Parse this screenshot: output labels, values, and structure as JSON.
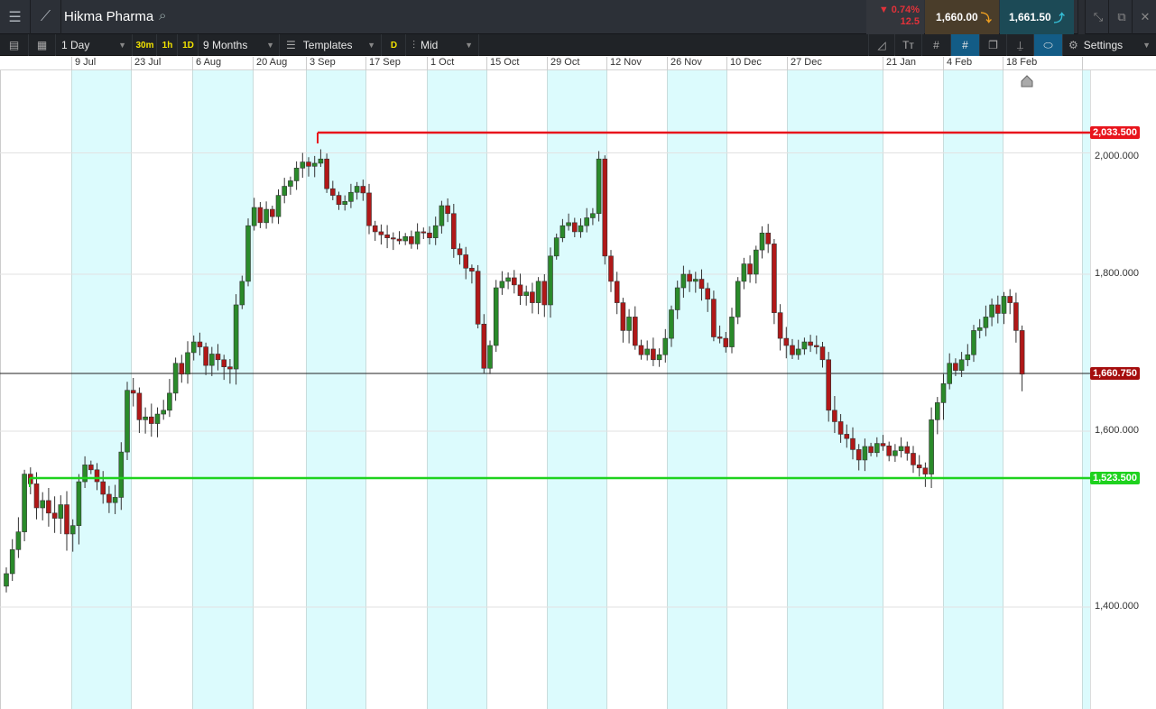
{
  "header": {
    "title": "Hikma Pharma",
    "change_pct": "0.74%",
    "change_abs": "12.5",
    "sell_price": "1,660.00",
    "buy_price": "1,661.50"
  },
  "toolbar": {
    "interval": "1 Day",
    "quick": [
      "30m",
      "1h",
      "1D"
    ],
    "range": "9 Months",
    "templates": "Templates",
    "d_label": "D",
    "price_type": "Mid",
    "settings": "Settings"
  },
  "colors": {
    "up": "#2a8a2a",
    "down": "#b01818",
    "resistance": "#e8141c",
    "support": "#1ed21e",
    "band": "#dcfbfd"
  },
  "chart_data": {
    "type": "candlestick",
    "x_tick_labels": [
      "9 Jul",
      "23 Jul",
      "6 Aug",
      "20 Aug",
      "3 Sep",
      "17 Sep",
      "1 Oct",
      "15 Oct",
      "29 Oct",
      "12 Nov",
      "26 Nov",
      "10 Dec",
      "27 Dec",
      "21 Jan",
      "4 Feb",
      "18 Feb"
    ],
    "y_tick_labels": [
      "1,400.000",
      "1,600.000",
      "1,800.000",
      "2,000.000"
    ],
    "y_ticks": [
      1400,
      1600,
      1800,
      2000
    ],
    "hlines": [
      {
        "label": "2,033.500",
        "value": 2033.5,
        "kind": "resistance"
      },
      {
        "label": "1,523.500",
        "value": 1523.5,
        "kind": "support"
      }
    ],
    "current": {
      "label": "1,660.750",
      "value": 1660.75
    },
    "first_open": 1420,
    "closes": [
      1432,
      1455,
      1472,
      1530,
      1518,
      1495,
      1502,
      1490,
      1485,
      1498,
      1470,
      1478,
      1520,
      1545,
      1537,
      1520,
      1508,
      1500,
      1505,
      1566,
      1643,
      1640,
      1612,
      1615,
      1608,
      1618,
      1622,
      1640,
      1675,
      1660,
      1690,
      1705,
      1698,
      1672,
      1688,
      1680,
      1670,
      1667,
      1757,
      1790,
      1880,
      1910,
      1885,
      1907,
      1895,
      1930,
      1945,
      1954,
      1975,
      1985,
      1978,
      1983,
      1990,
      1941,
      1930,
      1915,
      1920,
      1935,
      1945,
      1934,
      1880,
      1870,
      1865,
      1860,
      1858,
      1855,
      1862,
      1850,
      1870,
      1868,
      1860,
      1880,
      1913,
      1900,
      1842,
      1832,
      1810,
      1805,
      1730,
      1668,
      1700,
      1781,
      1790,
      1795,
      1785,
      1770,
      1775,
      1760,
      1790,
      1757,
      1830,
      1860,
      1880,
      1885,
      1870,
      1880,
      1893,
      1900,
      1990,
      1830,
      1790,
      1760,
      1721,
      1740,
      1700,
      1687,
      1695,
      1680,
      1687,
      1710,
      1750,
      1781,
      1800,
      1790,
      1793,
      1780,
      1765,
      1712,
      1710,
      1698,
      1740,
      1790,
      1817,
      1800,
      1840,
      1868,
      1850,
      1746,
      1710,
      1700,
      1687,
      1695,
      1705,
      1700,
      1698,
      1680,
      1622,
      1610,
      1595,
      1588,
      1570,
      1553,
      1575,
      1565,
      1580,
      1576,
      1560,
      1568,
      1575,
      1564,
      1545,
      1540,
      1530,
      1612,
      1630,
      1650,
      1675,
      1665,
      1680,
      1687,
      1721,
      1725,
      1740,
      1757,
      1745,
      1769,
      1760,
      1721,
      1660
    ]
  }
}
